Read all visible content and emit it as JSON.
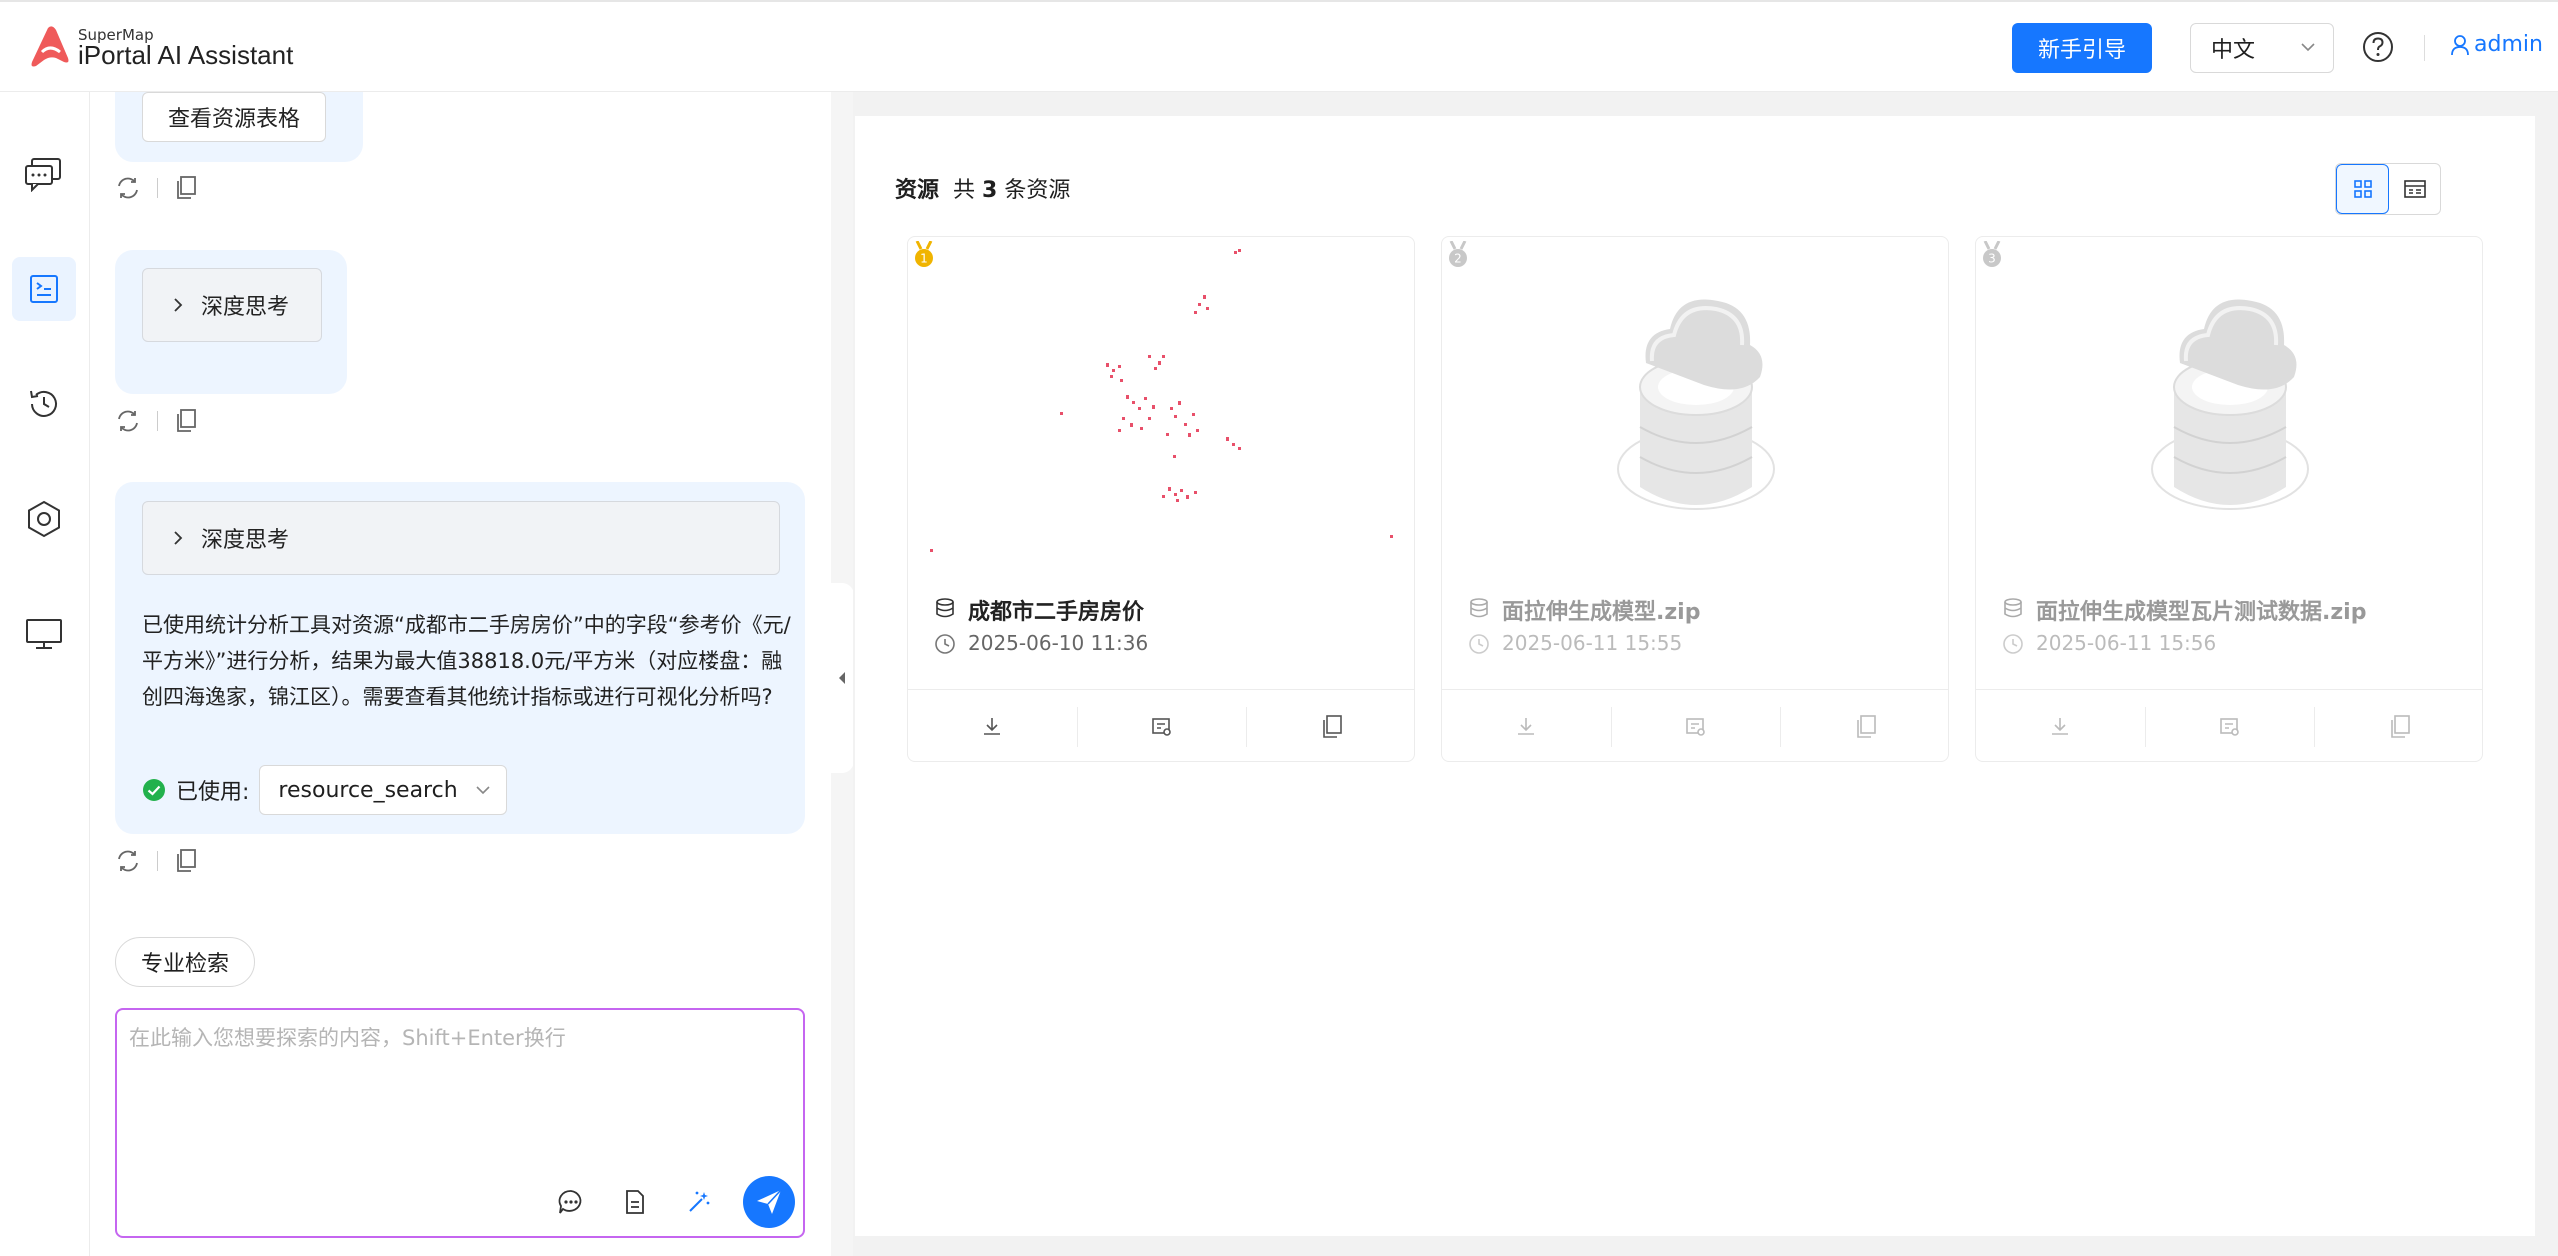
{
  "header": {
    "logo_sub": "SuperMap",
    "logo_title": "iPortal AI Assistant",
    "guide_button": "新手引导",
    "language": "中文",
    "user": "admin",
    "accent": "#1677ff"
  },
  "leftnav": {
    "items": [
      {
        "icon": "chat-bubbles-icon"
      },
      {
        "icon": "terminal-doc-icon",
        "active": true
      },
      {
        "icon": "history-icon"
      },
      {
        "icon": "hexagon-settings-icon"
      },
      {
        "icon": "monitor-icon"
      }
    ]
  },
  "chat": {
    "view_table_button": "查看资源表格",
    "think_label_1": "深度思考",
    "think_label_2": "深度思考",
    "answer": "已使用统计分析工具对资源“成都市二手房房价”中的字段“参考价《元/平方米》”进行分析，结果为最大值38818.0元/平方米（对应楼盘：融创四海逸家，锦江区）。需要查看其他统计指标或进行可视化分析吗?",
    "used_label": "已使用:",
    "used_tool": "resource_search",
    "pro_search": "专业检索",
    "input_placeholder": "在此输入您想要探索的内容，Shift+Enter换行"
  },
  "resources": {
    "label": "资源",
    "total_prefix": "共",
    "total_count": "3",
    "total_suffix": "条资源",
    "cards": [
      {
        "rank": "1",
        "title": "成都市二手房房价",
        "date": "2025-06-10 11:36",
        "rank_color": "#f0b400"
      },
      {
        "rank": "2",
        "title": "面拉伸生成模型.zip",
        "date": "2025-06-11 15:55",
        "rank_color": "#c8c8c8"
      },
      {
        "rank": "3",
        "title": "面拉伸生成模型瓦片测试数据.zip",
        "date": "2025-06-11 15:56",
        "rank_color": "#c8c8c8"
      }
    ]
  }
}
